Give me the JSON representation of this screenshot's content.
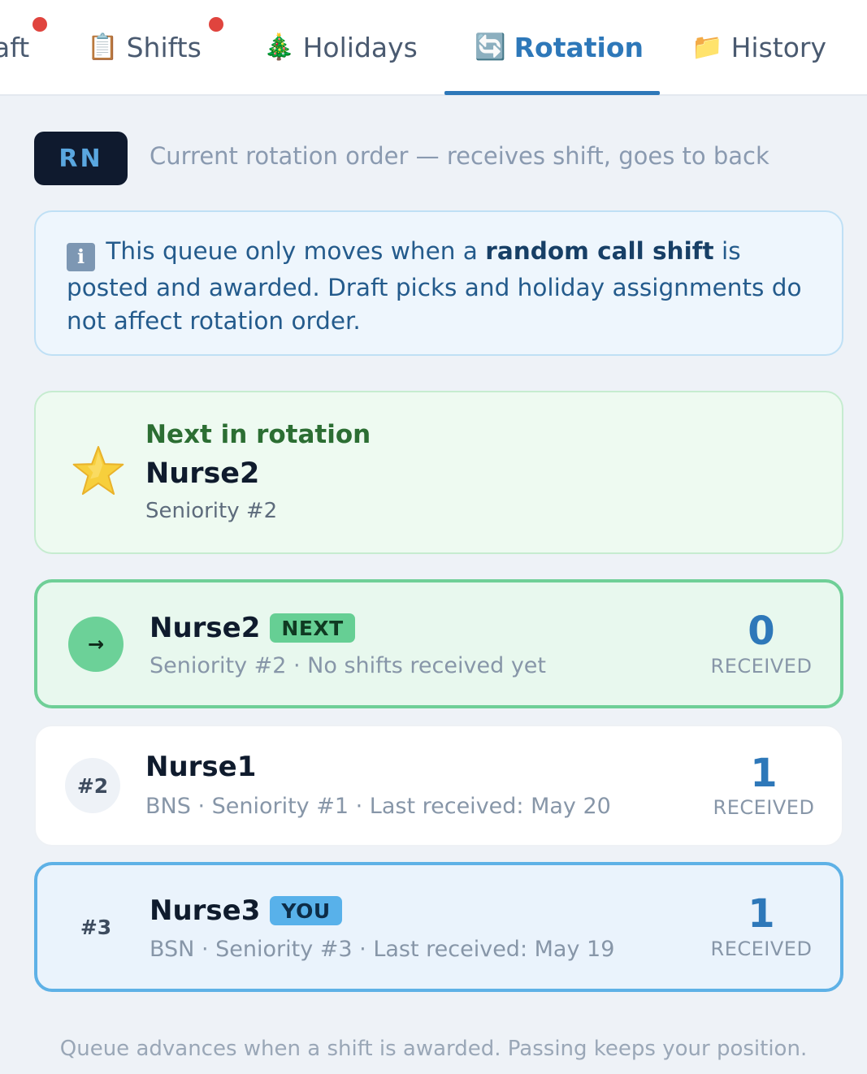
{
  "tabs": [
    {
      "label": "aft",
      "icon": "",
      "active": false
    },
    {
      "label": "Shifts",
      "icon": "📋",
      "active": false
    },
    {
      "label": "Holidays",
      "icon": "🎄",
      "active": false
    },
    {
      "label": "Rotation",
      "icon": "🔄",
      "active": true
    },
    {
      "label": "History",
      "icon": "📁",
      "active": false
    }
  ],
  "header": {
    "role": "RN",
    "description": "Current rotation order — receives shift, goes to back"
  },
  "info": {
    "icon": "ℹ",
    "text_before": "This queue only moves when a ",
    "text_bold": "random call shift",
    "text_after": " is posted and awarded. Draft picks and holiday assignments do not affect rotation order."
  },
  "next_card": {
    "icon": "star-icon",
    "label": "Next in rotation",
    "name": "Nurse2",
    "seniority": "Seniority #2"
  },
  "rotation": [
    {
      "position": "→",
      "name": "Nurse2",
      "badge": "NEXT",
      "details": "Seniority #2 · No shifts received yet",
      "count": "0",
      "count_label": "RECEIVED"
    },
    {
      "position": "#2",
      "name": "Nurse1",
      "badge": "",
      "details": "BNS · Seniority #1 · Last received: May 20",
      "count": "1",
      "count_label": "RECEIVED"
    },
    {
      "position": "#3",
      "name": "Nurse3",
      "badge": "YOU",
      "details": "BSN · Seniority #3 · Last received: May 19",
      "count": "1",
      "count_label": "RECEIVED"
    }
  ],
  "footer": "Queue advances when a shift is awarded. Passing keeps your position.",
  "colors": {
    "accent": "#2e78b9",
    "next_green": "#6fcf97",
    "you_blue": "#5eb1e6",
    "notification_dot": "#e0443e"
  }
}
